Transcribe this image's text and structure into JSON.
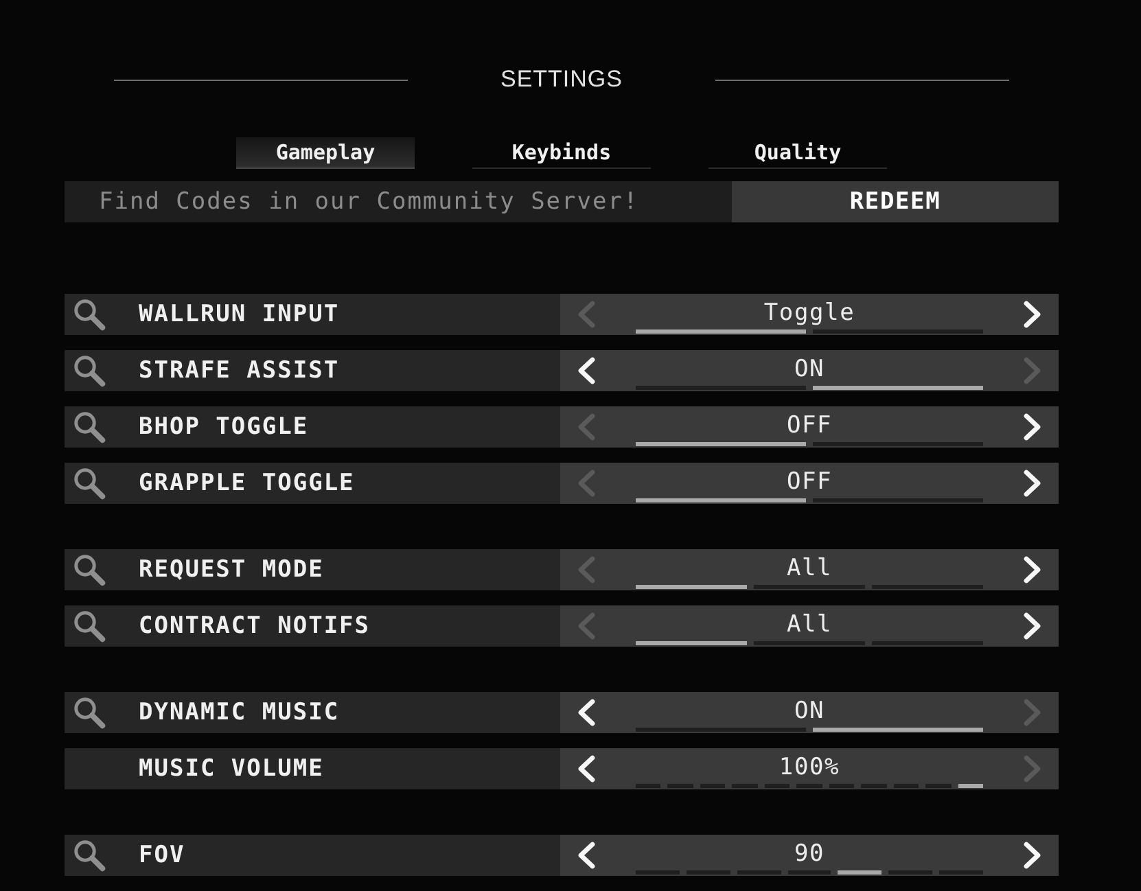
{
  "title": "SETTINGS",
  "tabs": [
    {
      "label": "Gameplay",
      "selected": true
    },
    {
      "label": "Keybinds",
      "selected": false
    },
    {
      "label": "Quality",
      "selected": false
    }
  ],
  "code_bar": {
    "placeholder": "Find Codes in our Community Server!",
    "button": "REDEEM"
  },
  "groups": [
    {
      "rows": [
        {
          "label": "WALLRUN INPUT",
          "search_icon": true,
          "value": "Toggle",
          "left_arrow": {
            "disabled": true
          },
          "right_arrow": {
            "disabled": false
          },
          "segments": [
            {
              "selected": true
            },
            {
              "selected": false
            }
          ]
        },
        {
          "label": "STRAFE ASSIST",
          "search_icon": true,
          "value": "ON",
          "left_arrow": {
            "disabled": false
          },
          "right_arrow": {
            "disabled": true
          },
          "segments": [
            {
              "selected": false
            },
            {
              "selected": true
            }
          ]
        },
        {
          "label": "BHOP TOGGLE",
          "search_icon": true,
          "value": "OFF",
          "left_arrow": {
            "disabled": true
          },
          "right_arrow": {
            "disabled": false
          },
          "segments": [
            {
              "selected": true
            },
            {
              "selected": false
            }
          ]
        },
        {
          "label": "GRAPPLE TOGGLE",
          "search_icon": true,
          "value": "OFF",
          "left_arrow": {
            "disabled": true
          },
          "right_arrow": {
            "disabled": false
          },
          "segments": [
            {
              "selected": true
            },
            {
              "selected": false
            }
          ]
        }
      ]
    },
    {
      "rows": [
        {
          "label": "REQUEST MODE",
          "search_icon": true,
          "value": "All",
          "left_arrow": {
            "disabled": true
          },
          "right_arrow": {
            "disabled": false
          },
          "segments": [
            {
              "selected": true
            },
            {
              "selected": false
            },
            {
              "selected": false
            }
          ]
        },
        {
          "label": "CONTRACT NOTIFS",
          "search_icon": true,
          "value": "All",
          "left_arrow": {
            "disabled": true
          },
          "right_arrow": {
            "disabled": false
          },
          "segments": [
            {
              "selected": true
            },
            {
              "selected": false
            },
            {
              "selected": false
            }
          ]
        }
      ]
    },
    {
      "rows": [
        {
          "label": "DYNAMIC MUSIC",
          "search_icon": true,
          "value": "ON",
          "left_arrow": {
            "disabled": false
          },
          "right_arrow": {
            "disabled": true
          },
          "segments": [
            {
              "selected": false
            },
            {
              "selected": true
            }
          ]
        },
        {
          "label": "MUSIC VOLUME",
          "search_icon": false,
          "value": "100%",
          "left_arrow": {
            "disabled": false
          },
          "right_arrow": {
            "disabled": true
          },
          "segments": [
            {
              "selected": false
            },
            {
              "selected": false
            },
            {
              "selected": false
            },
            {
              "selected": false
            },
            {
              "selected": false
            },
            {
              "selected": false
            },
            {
              "selected": false
            },
            {
              "selected": false
            },
            {
              "selected": false
            },
            {
              "selected": false
            },
            {
              "selected": true
            }
          ]
        }
      ]
    },
    {
      "rows": [
        {
          "label": "FOV",
          "search_icon": true,
          "value": "90",
          "left_arrow": {
            "disabled": false
          },
          "right_arrow": {
            "disabled": false
          },
          "segments": [
            {
              "selected": false
            },
            {
              "selected": false
            },
            {
              "selected": false
            },
            {
              "selected": false
            },
            {
              "selected": true
            },
            {
              "selected": false
            },
            {
              "selected": false
            }
          ]
        }
      ]
    }
  ]
}
